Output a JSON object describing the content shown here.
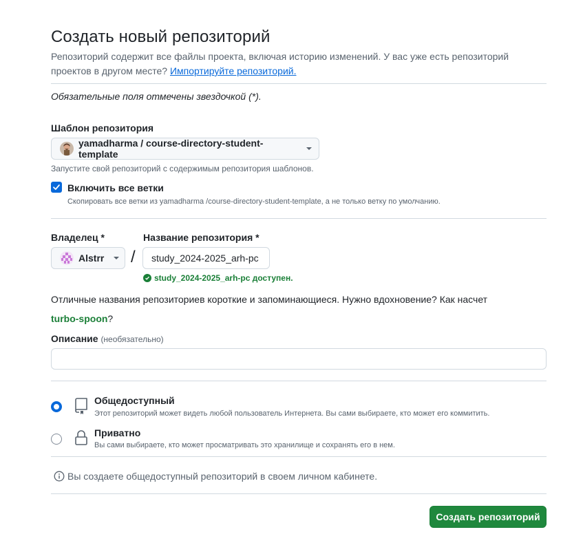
{
  "page": {
    "title": "Создать новый репозиторий",
    "subtitle_prefix": "Репозиторий содержит все файлы проекта, включая историю изменений. У вас уже есть репозиторий проектов в другом месте? ",
    "import_link": "Импортируйте репозиторий.",
    "required_note": "Обязательные поля отмечены звездочкой (*)."
  },
  "template": {
    "label": "Шаблон репозитория",
    "selected": "yamadharma / course-directory-student-template",
    "hint": "Запустите свой репозиторий с содержимым репозитория шаблонов.",
    "include_branches_label": "Включить все ветки",
    "include_branches_checked": true,
    "include_branches_hint": "Скопировать все ветки из yamadharma /course-directory-student-template, а не только ветку по умолчанию."
  },
  "owner": {
    "label": "Владелец *",
    "value": "Alstrr"
  },
  "repo_name": {
    "label": "Название репозитория *",
    "value": "study_2024-2025_arh-pc",
    "available_msg": "study_2024-2025_arh-pc доступен.",
    "separator": "/"
  },
  "inspiration": {
    "text": "Отличные названия репозиториев короткие и запоминающиеся. Нужно вдохновение? Как насчет ",
    "suggestion": "turbo-spoon",
    "suffix": "?"
  },
  "description": {
    "label": "Описание",
    "optional": "(необязательно)",
    "value": "",
    "placeholder": ""
  },
  "visibility": {
    "selected": "public",
    "options": [
      {
        "title": "Общедоступный",
        "desc": "Этот репозиторий может видеть любой пользователь Интернета. Вы сами выбираете, кто может его коммитить.",
        "icon": "repo-book-icon"
      },
      {
        "title": "Приватно",
        "desc": "Вы сами выбираете, кто может просматривать это хранилище и сохранять его в нем.",
        "icon": "lock-icon"
      }
    ]
  },
  "info_note": "Вы создаете общедоступный репозиторий в своем личном кабинете.",
  "submit_label": "Создать репозиторий",
  "colors": {
    "accent": "#0969da",
    "success": "#1a7f37",
    "primary_button": "#1f883d"
  }
}
